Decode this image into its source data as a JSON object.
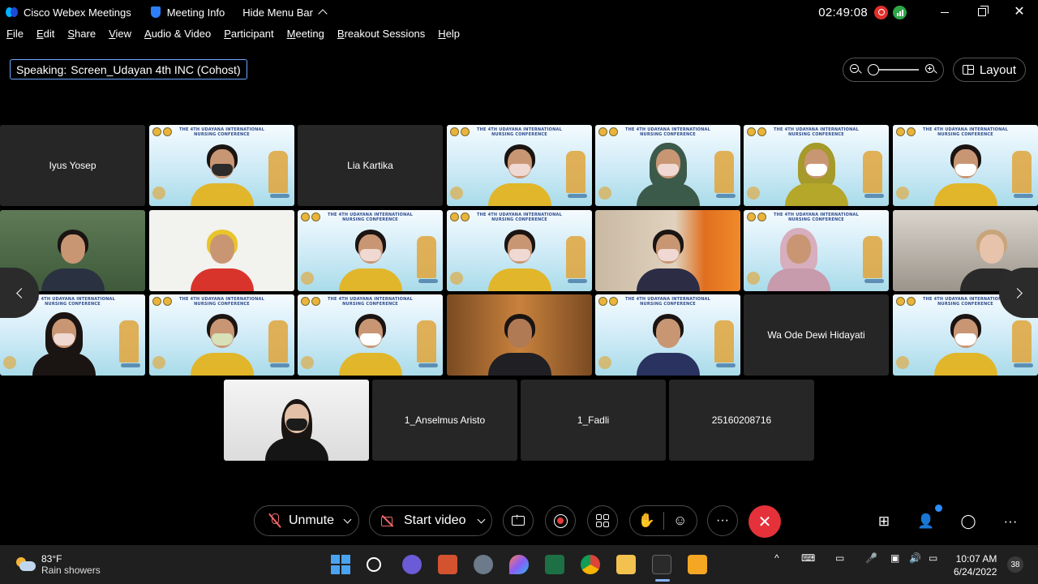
{
  "titlebar": {
    "app_name": "Cisco Webex Meetings",
    "meeting_info": "Meeting Info",
    "hide_menu": "Hide Menu Bar",
    "clock": "02:49:08"
  },
  "menu": [
    "File",
    "Edit",
    "Share",
    "View",
    "Audio & Video",
    "Participant",
    "Meeting",
    "Breakout Sessions",
    "Help"
  ],
  "speaking": {
    "label": "Speaking:",
    "name": "Screen_Udayan 4th INC (Cohost)"
  },
  "layout_label": "Layout",
  "conference_banner": "THE 4TH UDAYANA INTERNATIONAL NURSING CONFERENCE",
  "participants": {
    "iyus": "Iyus Yosep",
    "lia": "Lia Kartika",
    "wa_ode": "Wa Ode Dewi Hidayati",
    "anselmus": "1_Anselmus Aristo",
    "fadli": "1_Fadli",
    "number": "25160208716"
  },
  "controls": {
    "unmute": "Unmute",
    "start_video": "Start video"
  },
  "taskbar": {
    "temp": "83°F",
    "weather": "Rain showers",
    "time": "10:07 AM",
    "date": "6/24/2022",
    "notifications": "38"
  },
  "colors": {
    "end_call": "#e5313a",
    "accent": "#2d8cff",
    "speaking_border": "#6fa8ff"
  }
}
